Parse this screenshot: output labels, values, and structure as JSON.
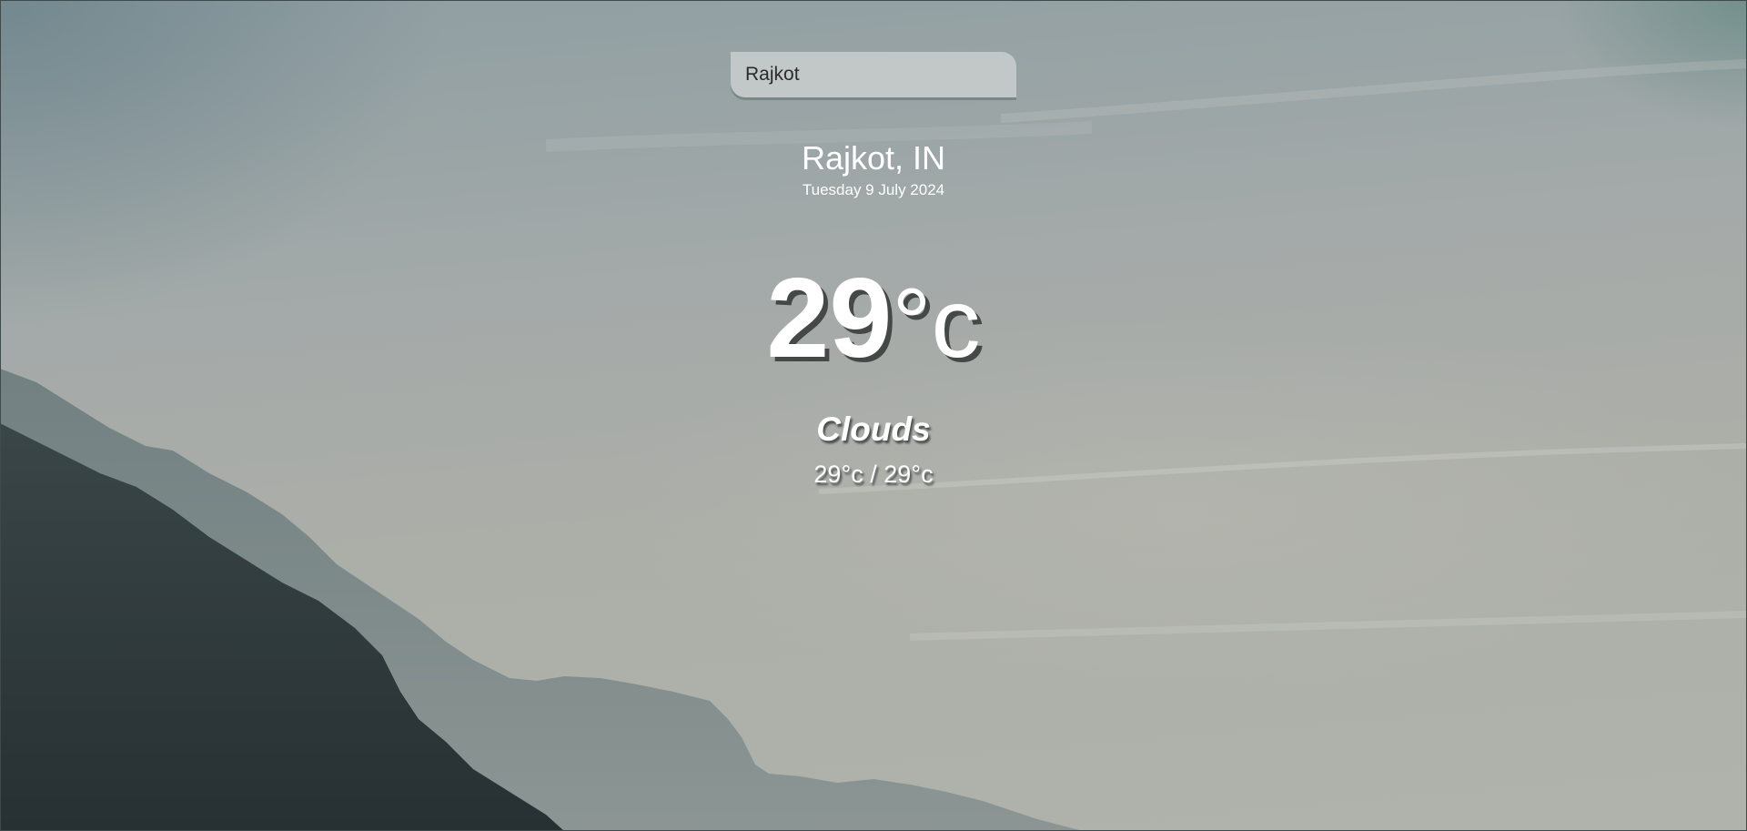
{
  "search": {
    "value": "Rajkot"
  },
  "location": {
    "city": "Rajkot, IN",
    "date": "Tuesday 9 July 2024"
  },
  "current": {
    "temp": "29",
    "unit": "°c"
  },
  "weather": {
    "condition": "Clouds",
    "hi_low": "29°c / 29°c"
  },
  "colors": {
    "text": "#ffffff",
    "sky": "#a8adaa",
    "mountain_dark": "#2c3537",
    "mountain_light": "#5e6d70"
  },
  "icons": {
    "background": "mountain-landscape-background"
  }
}
